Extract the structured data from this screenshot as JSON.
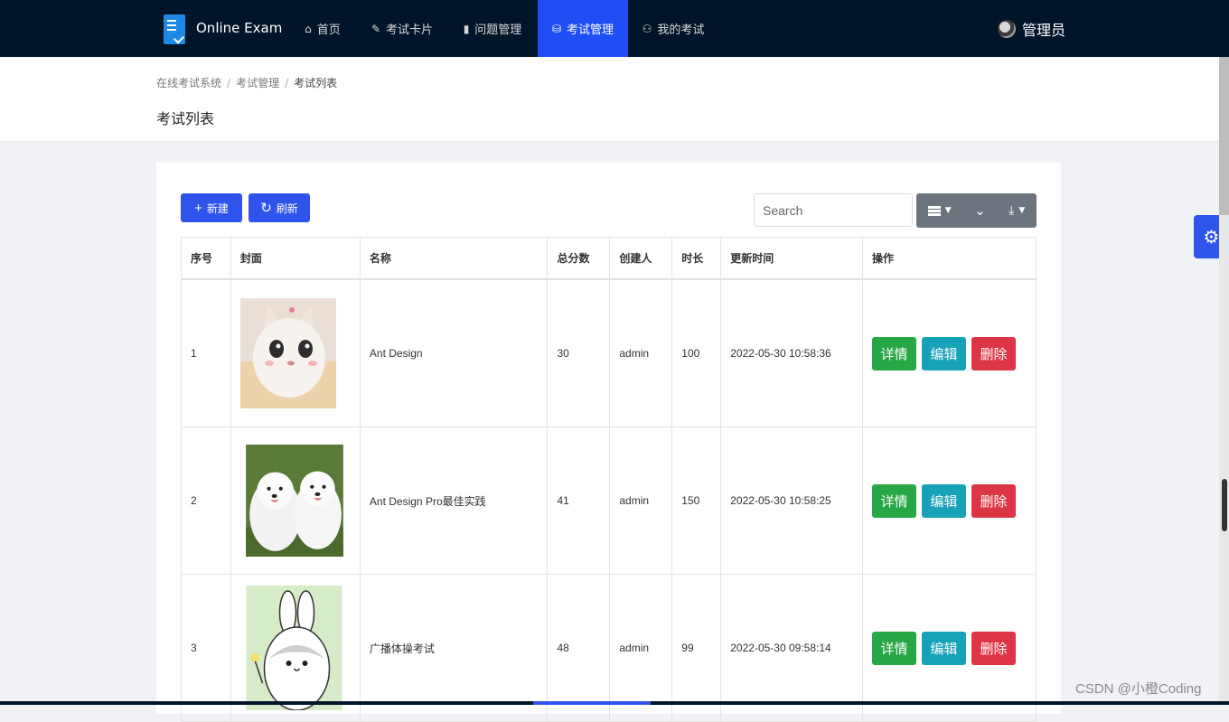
{
  "app": {
    "brand": "Online Exam"
  },
  "nav": [
    {
      "icon": "home-icon",
      "glyph": "⌂",
      "label": "首页"
    },
    {
      "icon": "rocket-icon",
      "glyph": "✎",
      "label": "考试卡片"
    },
    {
      "icon": "book-icon",
      "glyph": "▮",
      "label": "问题管理"
    },
    {
      "icon": "database-icon",
      "glyph": "⛁",
      "label": "考试管理",
      "active": true
    },
    {
      "icon": "user-icon",
      "glyph": "⚇",
      "label": "我的考试"
    }
  ],
  "user": {
    "name": "管理员"
  },
  "breadcrumb": [
    "在线考试系统",
    "考试管理",
    "考试列表"
  ],
  "page": {
    "title": "考试列表"
  },
  "toolbar": {
    "new_label": "新建",
    "refresh_label": "刷新",
    "search_placeholder": "Search"
  },
  "table": {
    "headers": [
      "序号",
      "封面",
      "名称",
      "总分数",
      "创建人",
      "时长",
      "更新时间",
      "操作"
    ],
    "rows": [
      {
        "index": "1",
        "cover": "cat-cover-image",
        "name": "Ant Design",
        "score": "30",
        "creator": "admin",
        "duration": "100",
        "updated": "2022-05-30 10:58:36"
      },
      {
        "index": "2",
        "cover": "dogs-cover-image",
        "name": "Ant Design Pro最佳实践",
        "score": "41",
        "creator": "admin",
        "duration": "150",
        "updated": "2022-05-30 10:58:25"
      },
      {
        "index": "3",
        "cover": "rabbit-cover-image",
        "name": "广播体操考试",
        "score": "48",
        "creator": "admin",
        "duration": "99",
        "updated": "2022-05-30 09:58:14"
      }
    ],
    "actions": {
      "detail": "详情",
      "edit": "编辑",
      "delete": "删除"
    }
  },
  "watermark": "CSDN @小橙Coding",
  "colors": {
    "nav_bg": "#001529",
    "accent": "#2f54eb",
    "detail": "#28a745",
    "edit": "#17a2b8",
    "delete": "#dc3545"
  }
}
